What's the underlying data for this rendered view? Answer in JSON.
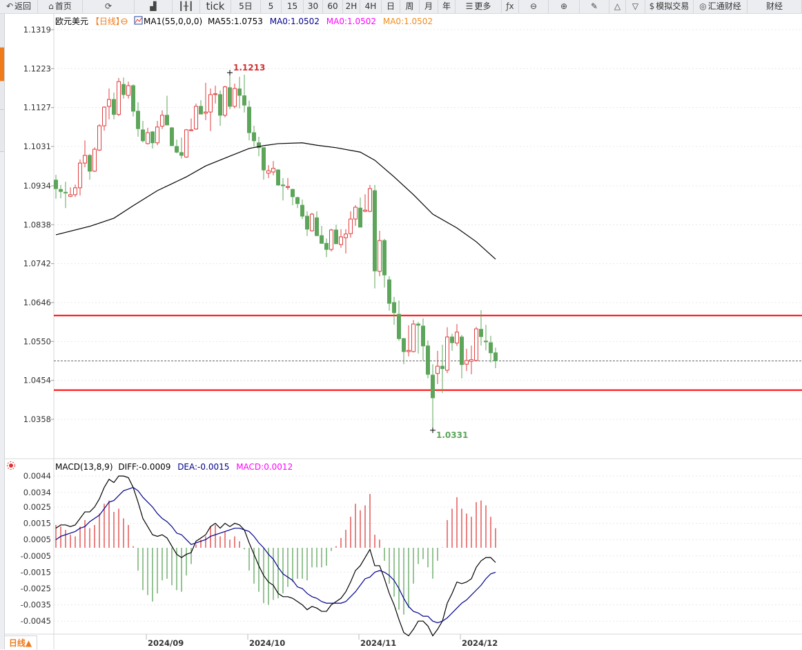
{
  "toolbar": {
    "items": [
      {
        "label": "返回",
        "icon": "back-arrow-icon"
      },
      {
        "label": "首页",
        "icon": "home-icon"
      },
      {
        "label": "",
        "icon": "refresh-icon"
      },
      {
        "label": "",
        "icon": "bar-chart-icon"
      },
      {
        "label": "",
        "icon": "candlestick-icon"
      },
      {
        "label": "tick",
        "icon": ""
      },
      {
        "label": "5日",
        "icon": ""
      },
      {
        "label": "5",
        "icon": ""
      },
      {
        "label": "15",
        "icon": ""
      },
      {
        "label": "30",
        "icon": ""
      },
      {
        "label": "60",
        "icon": ""
      },
      {
        "label": "2H",
        "icon": ""
      },
      {
        "label": "4H",
        "icon": ""
      },
      {
        "label": "日",
        "icon": ""
      },
      {
        "label": "周",
        "icon": ""
      },
      {
        "label": "月",
        "icon": ""
      },
      {
        "label": "年",
        "icon": ""
      },
      {
        "label": "更多",
        "icon": "menu-icon"
      },
      {
        "label": "",
        "icon": "fx-icon"
      },
      {
        "label": "",
        "icon": "zoom-out-icon"
      },
      {
        "label": "",
        "icon": "zoom-in-icon"
      },
      {
        "label": "",
        "icon": "pen-icon"
      },
      {
        "label": "",
        "icon": "triangle-up-icon"
      },
      {
        "label": "",
        "icon": "triangle-down-icon"
      },
      {
        "label": "模拟交易",
        "icon": "dollar-icon"
      },
      {
        "label": "汇通财经",
        "icon": "swirl-logo-icon"
      },
      {
        "label": "财经",
        "icon": ""
      }
    ]
  },
  "legend": {
    "symbol": "欧元美元",
    "period": "【日线】",
    "ma_name": "MA1(55,0,0,0)",
    "ma55": "MA55:1.0753",
    "ma0_a": "MA0:1.0502",
    "ma0_b": "MA0:1.0502",
    "ma0_c": "MA0:1.0502"
  },
  "macd_legend": {
    "name": "MACD(13,8,9)",
    "diff": "DIFF:-0.0009",
    "dea": "DEA:-0.0015",
    "macd": "MACD:0.0012"
  },
  "period_button": "日线",
  "colors": {
    "up": "#e03c3c",
    "down": "#5ca55a",
    "ma55": "#000000",
    "dea": "#00008b",
    "macd_label": "#ff00ff",
    "accent": "#f07a1a",
    "level_line": "#ff0000"
  },
  "chart_data": [
    {
      "type": "candlestick",
      "price_ticks": [
        "1.1319",
        "1.1223",
        "1.1127",
        "1.1031",
        "1.0934",
        "1.0838",
        "1.0742",
        "1.0646",
        "1.0550",
        "1.0454",
        "1.0358"
      ],
      "x_ticks": [
        {
          "label": "2024/09",
          "bar": 19
        },
        {
          "label": "2024/10",
          "bar": 40
        },
        {
          "label": "2024/11",
          "bar": 63
        },
        {
          "label": "2024/12",
          "bar": 84
        }
      ],
      "annotations": [
        {
          "text": "1.1213",
          "bar": 36,
          "value": 1.1213,
          "kind": "high"
        },
        {
          "text": "1.0331",
          "bar": 78,
          "value": 1.0331,
          "kind": "low"
        }
      ],
      "horizontal_lines": [
        1.0614,
        1.043
      ],
      "current_price": 1.0502,
      "ohlc": [
        [
          1.0948,
          1.0961,
          1.0902,
          1.0927
        ],
        [
          1.0925,
          1.0936,
          1.0903,
          1.092
        ],
        [
          1.0918,
          1.0944,
          1.0879,
          1.0917
        ],
        [
          1.0908,
          1.093,
          1.0906,
          1.0912
        ],
        [
          1.0912,
          1.0937,
          1.0906,
          1.0929
        ],
        [
          1.0929,
          1.0999,
          1.091,
          1.099
        ],
        [
          1.099,
          1.1046,
          1.098,
          1.1009
        ],
        [
          1.1009,
          1.1012,
          1.0949,
          1.097
        ],
        [
          1.097,
          1.1029,
          1.0968,
          1.1024
        ],
        [
          1.1022,
          1.1086,
          1.102,
          1.1082
        ],
        [
          1.1082,
          1.113,
          1.107,
          1.1128
        ],
        [
          1.113,
          1.1174,
          1.1098,
          1.1147
        ],
        [
          1.1147,
          1.1164,
          1.1098,
          1.111
        ],
        [
          1.111,
          1.12,
          1.1106,
          1.1191
        ],
        [
          1.1184,
          1.1201,
          1.1149,
          1.1159
        ],
        [
          1.1157,
          1.1191,
          1.1149,
          1.1181
        ],
        [
          1.1181,
          1.1184,
          1.1105,
          1.1118
        ],
        [
          1.1118,
          1.114,
          1.1055,
          1.1075
        ],
        [
          1.1072,
          1.1094,
          1.1041,
          1.1045
        ],
        [
          1.1038,
          1.1077,
          1.1036,
          1.1065
        ],
        [
          1.1067,
          1.1069,
          1.1026,
          1.104
        ],
        [
          1.104,
          1.1094,
          1.1034,
          1.1079
        ],
        [
          1.1081,
          1.112,
          1.1074,
          1.1108
        ],
        [
          1.1108,
          1.1156,
          1.1084,
          1.1084
        ],
        [
          1.1077,
          1.1079,
          1.1033,
          1.1033
        ],
        [
          1.1031,
          1.1048,
          1.1014,
          1.1017
        ],
        [
          1.1016,
          1.1053,
          1.1001,
          1.1009
        ],
        [
          1.1005,
          1.1074,
          1.1003,
          1.1072
        ],
        [
          1.107,
          1.11,
          1.1069,
          1.1072
        ],
        [
          1.1074,
          1.1137,
          1.1072,
          1.113
        ],
        [
          1.113,
          1.1145,
          1.111,
          1.1111
        ],
        [
          1.1113,
          1.1188,
          1.1096,
          1.1116
        ],
        [
          1.1116,
          1.1174,
          1.1069,
          1.1159
        ],
        [
          1.1159,
          1.1181,
          1.1137,
          1.1161
        ],
        [
          1.1159,
          1.1169,
          1.1082,
          1.1108
        ],
        [
          1.1108,
          1.1181,
          1.1103,
          1.1178
        ],
        [
          1.1176,
          1.1213,
          1.1123,
          1.113
        ],
        [
          1.113,
          1.1186,
          1.1125,
          1.1174
        ],
        [
          1.1173,
          1.1203,
          1.1125,
          1.1157
        ],
        [
          1.1156,
          1.1208,
          1.1115,
          1.1133
        ],
        [
          1.1128,
          1.1144,
          1.1046,
          1.1065
        ],
        [
          1.1065,
          1.1082,
          1.1031,
          1.1045
        ],
        [
          1.104,
          1.1055,
          1.1007,
          1.1028
        ],
        [
          1.1028,
          1.1028,
          1.0949,
          1.0973
        ],
        [
          1.0965,
          1.0985,
          1.0953,
          1.0971
        ],
        [
          1.0968,
          1.0995,
          1.096,
          1.0977
        ],
        [
          1.0973,
          1.0975,
          1.0934,
          1.0936
        ],
        [
          1.0936,
          1.0953,
          1.0898,
          1.0934
        ],
        [
          1.093,
          1.0953,
          1.0924,
          1.0932
        ],
        [
          1.0925,
          1.0927,
          1.0886,
          1.0907
        ],
        [
          1.0905,
          1.0907,
          1.0879,
          1.089
        ],
        [
          1.0886,
          1.09,
          1.0852,
          1.0859
        ],
        [
          1.0859,
          1.0871,
          1.081,
          1.0827
        ],
        [
          1.0823,
          1.0867,
          1.0821,
          1.0864
        ],
        [
          1.0855,
          1.0871,
          1.081,
          1.0811
        ],
        [
          1.0811,
          1.0835,
          1.0791,
          1.0792
        ],
        [
          1.0792,
          1.0804,
          1.0758,
          1.0777
        ],
        [
          1.0777,
          1.0828,
          1.0772,
          1.0825
        ],
        [
          1.0825,
          1.0838,
          1.0791,
          1.0791
        ],
        [
          1.0789,
          1.0827,
          1.0781,
          1.0808
        ],
        [
          1.0806,
          1.0827,
          1.0767,
          1.0815
        ],
        [
          1.0816,
          1.0871,
          1.0806,
          1.0852
        ],
        [
          1.0852,
          1.0886,
          1.0835,
          1.0881
        ],
        [
          1.0879,
          1.0905,
          1.0832,
          1.0832
        ],
        [
          1.0871,
          1.0913,
          1.0869,
          1.0874
        ],
        [
          1.0871,
          1.0936,
          1.0869,
          1.0927
        ],
        [
          1.0922,
          1.0936,
          1.0681,
          1.0724
        ],
        [
          1.0723,
          1.0823,
          1.0711,
          1.0799
        ],
        [
          1.0799,
          1.0803,
          1.0683,
          1.0714
        ],
        [
          1.0702,
          1.0711,
          1.0626,
          1.0644
        ],
        [
          1.0646,
          1.066,
          1.0591,
          1.0621
        ],
        [
          1.0617,
          1.0651,
          1.0552,
          1.0557
        ],
        [
          1.0557,
          1.0559,
          1.0494,
          1.0525
        ],
        [
          1.0525,
          1.059,
          1.0513,
          1.0528
        ],
        [
          1.0525,
          1.0603,
          1.0523,
          1.0593
        ],
        [
          1.0593,
          1.0598,
          1.052,
          1.059
        ],
        [
          1.0588,
          1.0607,
          1.0503,
          1.0539
        ],
        [
          1.0539,
          1.0552,
          1.0459,
          1.0469
        ],
        [
          1.0467,
          1.0494,
          1.0331,
          1.0411
        ],
        [
          1.0471,
          1.0527,
          1.0445,
          1.0489
        ],
        [
          1.0489,
          1.0542,
          1.0423,
          1.0483
        ],
        [
          1.0479,
          1.0585,
          1.0472,
          1.0561
        ],
        [
          1.0561,
          1.0569,
          1.0527,
          1.0547
        ],
        [
          1.0546,
          1.0593,
          1.0539,
          1.0573
        ],
        [
          1.0561,
          1.0566,
          1.0459,
          1.0493
        ],
        [
          1.0494,
          1.0532,
          1.0477,
          1.0503
        ],
        [
          1.0501,
          1.054,
          1.0469,
          1.0505
        ],
        [
          1.0503,
          1.0586,
          1.0501,
          1.0581
        ],
        [
          1.058,
          1.0627,
          1.054,
          1.0562
        ],
        [
          1.0551,
          1.0591,
          1.0528,
          1.0549
        ],
        [
          1.0547,
          1.0564,
          1.0498,
          1.0522
        ],
        [
          1.0522,
          1.0535,
          1.0484,
          1.0502
        ]
      ],
      "ma55": [
        [
          0,
          1.0813
        ],
        [
          7,
          1.0834
        ],
        [
          12,
          1.0854
        ],
        [
          16,
          1.0885
        ],
        [
          21,
          1.0922
        ],
        [
          27,
          1.0956
        ],
        [
          31,
          1.0983
        ],
        [
          36,
          1.1007
        ],
        [
          40,
          1.1026
        ],
        [
          43,
          1.1033
        ],
        [
          46,
          1.1038
        ],
        [
          51,
          1.104
        ],
        [
          54,
          1.1034
        ],
        [
          58,
          1.1028
        ],
        [
          63,
          1.1017
        ],
        [
          66,
          1.0997
        ],
        [
          70,
          1.0956
        ],
        [
          74,
          1.0912
        ],
        [
          78,
          1.0864
        ],
        [
          83,
          1.083
        ],
        [
          87,
          1.0796
        ],
        [
          91,
          1.0753
        ]
      ]
    },
    {
      "type": "macd",
      "y_ticks": [
        "0.0044",
        "0.0034",
        "0.0025",
        "0.0015",
        "0.0005",
        "-0.0005",
        "-0.0015",
        "-0.0025",
        "-0.0035",
        "-0.0045"
      ],
      "diff": [
        0.0012,
        0.0014,
        0.0014,
        0.0013,
        0.0014,
        0.0018,
        0.0022,
        0.0022,
        0.0025,
        0.003,
        0.0037,
        0.0042,
        0.004,
        0.0044,
        0.0044,
        0.0043,
        0.0037,
        0.0028,
        0.0018,
        0.0013,
        0.0008,
        0.0007,
        0.0008,
        0.0006,
        0.0001,
        -0.0004,
        -0.0006,
        -0.0004,
        -0.0003,
        0.0004,
        0.0006,
        0.0008,
        0.0013,
        0.0015,
        0.0012,
        0.0015,
        0.0013,
        0.0015,
        0.0014,
        0.0011,
        0.0003,
        -0.0004,
        -0.0011,
        -0.0017,
        -0.0021,
        -0.0023,
        -0.0028,
        -0.003,
        -0.003,
        -0.0031,
        -0.0033,
        -0.0035,
        -0.0038,
        -0.0036,
        -0.0037,
        -0.0039,
        -0.0039,
        -0.0035,
        -0.0033,
        -0.0031,
        -0.0027,
        -0.0021,
        -0.0014,
        -0.0011,
        -0.0006,
        -0.0001,
        -0.0011,
        -0.0011,
        -0.0019,
        -0.0028,
        -0.0035,
        -0.0044,
        -0.0052,
        -0.0054,
        -0.005,
        -0.0045,
        -0.0045,
        -0.0048,
        -0.0054,
        -0.005,
        -0.0045,
        -0.0034,
        -0.0028,
        -0.0021,
        -0.0022,
        -0.0021,
        -0.0019,
        -0.0012,
        -0.0008,
        -0.0006,
        -0.0006,
        -0.0009
      ],
      "dea": [
        0.0005,
        0.0007,
        0.0008,
        0.0009,
        0.001,
        0.0012,
        0.0013,
        0.0016,
        0.0018,
        0.002,
        0.0024,
        0.0028,
        0.0029,
        0.0032,
        0.0035,
        0.0036,
        0.0037,
        0.0035,
        0.0031,
        0.0028,
        0.0025,
        0.0021,
        0.0018,
        0.0016,
        0.0013,
        0.0009,
        0.0008,
        0.0005,
        0.0002,
        0.0003,
        0.0004,
        0.0005,
        0.0007,
        0.0008,
        0.0009,
        0.001,
        0.0011,
        0.0012,
        0.0012,
        0.0011,
        0.001,
        0.0007,
        0.0003,
        0.0,
        -0.0004,
        -0.0007,
        -0.0012,
        -0.0016,
        -0.0018,
        -0.002,
        -0.0024,
        -0.0025,
        -0.0028,
        -0.003,
        -0.0031,
        -0.0033,
        -0.0034,
        -0.0034,
        -0.0034,
        -0.0034,
        -0.0033,
        -0.003,
        -0.0027,
        -0.0023,
        -0.0019,
        -0.0018,
        -0.0015,
        -0.0014,
        -0.0015,
        -0.0017,
        -0.002,
        -0.0025,
        -0.0031,
        -0.0036,
        -0.0039,
        -0.004,
        -0.0042,
        -0.0042,
        -0.0045,
        -0.0046,
        -0.0045,
        -0.0043,
        -0.004,
        -0.0037,
        -0.0034,
        -0.0032,
        -0.0029,
        -0.0026,
        -0.0023,
        -0.0019,
        -0.0016,
        -0.0015
      ],
      "macd": [
        0.0014,
        0.0013,
        0.0011,
        0.0008,
        0.0007,
        0.0013,
        0.0017,
        0.0012,
        0.0014,
        0.0021,
        0.0027,
        0.0029,
        0.0022,
        0.0024,
        0.0018,
        0.0014,
        0.0001,
        -0.0014,
        -0.0026,
        -0.0029,
        -0.0033,
        -0.0028,
        -0.002,
        -0.0019,
        -0.0023,
        -0.0026,
        -0.0027,
        -0.0017,
        -0.001,
        0.0002,
        0.0005,
        0.0007,
        0.0013,
        0.0014,
        0.0007,
        0.001,
        0.0005,
        0.0007,
        0.0004,
        -0.0001,
        -0.0014,
        -0.0022,
        -0.0027,
        -0.0034,
        -0.0035,
        -0.0032,
        -0.0031,
        -0.0028,
        -0.0024,
        -0.0021,
        -0.0019,
        -0.0019,
        -0.002,
        -0.0012,
        -0.0012,
        -0.0012,
        -0.0011,
        -0.0002,
        0.0001,
        0.0006,
        0.0011,
        0.0019,
        0.0027,
        0.0023,
        0.0026,
        0.0033,
        0.0008,
        0.0005,
        -0.0008,
        -0.0022,
        -0.003,
        -0.0038,
        -0.0041,
        -0.0037,
        -0.0022,
        -0.001,
        -0.0007,
        -0.0012,
        -0.0019,
        -0.0008,
        0.0,
        0.0017,
        0.0024,
        0.0031,
        0.0024,
        0.0021,
        0.0019,
        0.0028,
        0.0029,
        0.0026,
        0.0019,
        0.0012
      ]
    }
  ]
}
